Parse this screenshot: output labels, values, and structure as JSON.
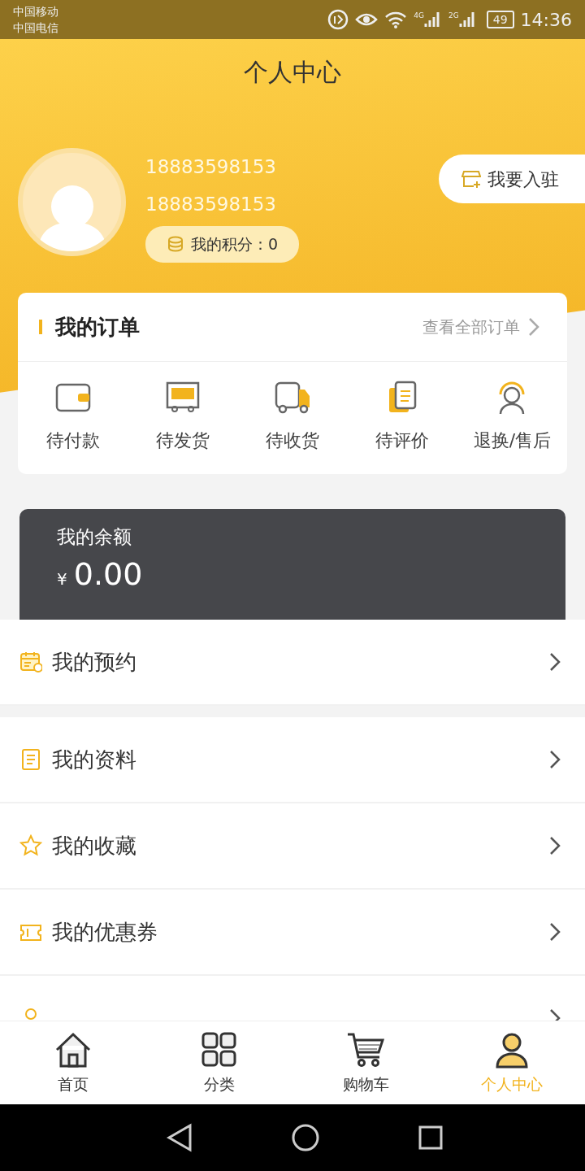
{
  "status_bar": {
    "carriers": [
      "中国移动",
      "中国电信"
    ],
    "network_labels": [
      "4G",
      "2G"
    ],
    "battery": "49",
    "time": "14:36"
  },
  "title": "个人中心",
  "profile": {
    "phone": "18883598153",
    "account": "18883598153",
    "points": "我的积分：0"
  },
  "join_button": "我要入驻",
  "orders": {
    "title": "我的订单",
    "view_all": "查看全部订单",
    "items": [
      {
        "label": "待付款",
        "kind": "wallet"
      },
      {
        "label": "待发货",
        "kind": "box"
      },
      {
        "label": "待收货",
        "kind": "truck"
      },
      {
        "label": "待评价",
        "kind": "document"
      },
      {
        "label": "退换/售后",
        "kind": "service"
      }
    ]
  },
  "balance": {
    "title": "我的余额",
    "currency": "¥",
    "amount": "0.00"
  },
  "menu_groups": [
    [
      {
        "label": "我的预约",
        "kind": "calendar"
      }
    ],
    [
      {
        "label": "我的资料",
        "kind": "note"
      },
      {
        "label": "我的收藏",
        "kind": "star"
      },
      {
        "label": "我的优惠券",
        "kind": "ticket"
      },
      {
        "kind": "person"
      }
    ]
  ],
  "tabs": [
    {
      "label": "首页",
      "kind": "home",
      "selected": false
    },
    {
      "label": "分类",
      "kind": "grid",
      "selected": false
    },
    {
      "label": "购物车",
      "kind": "cart",
      "selected": false
    },
    {
      "label": "个人中心",
      "kind": "user",
      "selected": true
    }
  ]
}
